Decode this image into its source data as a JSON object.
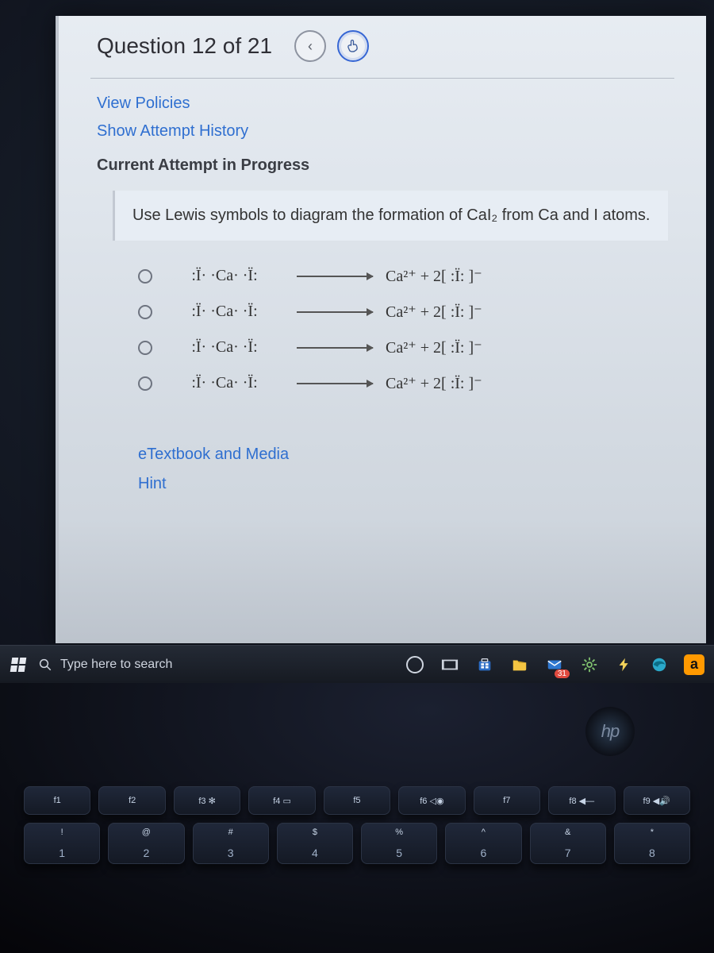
{
  "header": {
    "title": "Question 12 of 21",
    "prev_icon": "chevron-left-icon",
    "next_icon": "hand-pointer-icon"
  },
  "links": {
    "view_policies": "View Policies",
    "show_history": "Show Attempt History"
  },
  "progress": "Current Attempt in Progress",
  "prompt": "Use Lewis symbols to diagram the formation of CaI₂ from Ca and I atoms.",
  "options": [
    {
      "left": ":Ï·  ·Ca·  ·Ï:",
      "right": "Ca²⁺  +  2[ :Ï: ]⁻"
    },
    {
      "left": ":Ï·  ·Ca·  ·Ï:",
      "right": "Ca²⁺  +  2[ :Ï: ]⁻"
    },
    {
      "left": ":Ï·  ·Ca·  ·Ï:",
      "right": "Ca²⁺  +  2[ :Ï: ]⁻"
    },
    {
      "left": ":Ï·  ·Ca·  ·Ï:",
      "right": "Ca²⁺  +  2[ :Ï: ]⁻"
    }
  ],
  "etextbook": "eTextbook and Media",
  "hint": "Hint",
  "taskbar": {
    "search_placeholder": "Type here to search",
    "weather_badge": "31"
  },
  "hp_logo": "hp",
  "fn_row": [
    "f1",
    "f2",
    "f3 ✻",
    "f4 ▭",
    "f5",
    "f6 ◁◉",
    "f7",
    "f8 ◀—",
    "f9 ◀🔊"
  ],
  "num_row": [
    {
      "top": "!",
      "bottom": "1"
    },
    {
      "top": "@",
      "bottom": "2"
    },
    {
      "top": "#",
      "bottom": "3"
    },
    {
      "top": "$",
      "bottom": "4"
    },
    {
      "top": "%",
      "bottom": "5"
    },
    {
      "top": "^",
      "bottom": "6"
    },
    {
      "top": "&",
      "bottom": "7"
    },
    {
      "top": "*",
      "bottom": "8"
    }
  ],
  "amazon_label": "a"
}
